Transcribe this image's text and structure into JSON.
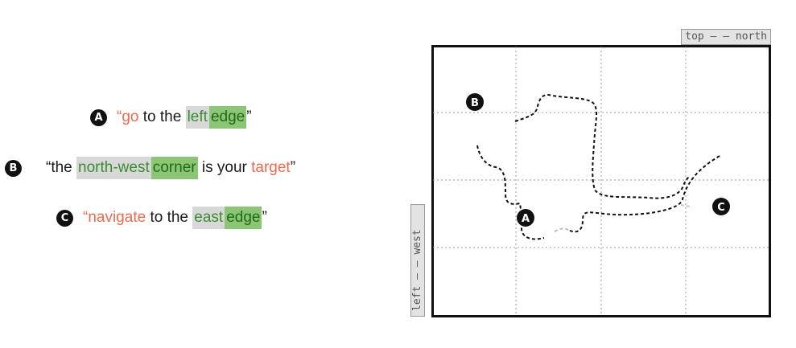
{
  "instructions": [
    {
      "badge": "A",
      "open": "“",
      "w1": "go",
      "w2": " to the ",
      "w3": "left",
      "w4": "edge",
      "close": "”"
    },
    {
      "badge": "B",
      "open": "“the ",
      "w1": "north-west",
      "w2": "corner",
      "w3": " is your ",
      "w4": "target",
      "close": "”"
    },
    {
      "badge": "C",
      "open": "“",
      "w1": "navigate",
      "w2": " to the ",
      "w3": "east",
      "w4": "edge",
      "close": "”"
    }
  ],
  "map": {
    "top_label": "top — — north",
    "left_label": "left — — west",
    "markers": [
      "A",
      "B",
      "C"
    ]
  },
  "colors": {
    "action_red": "#ee6a4f",
    "landmark_gray": "#d8d8d8",
    "target_green": "#8cc576",
    "text_green": "#3a8c30"
  }
}
